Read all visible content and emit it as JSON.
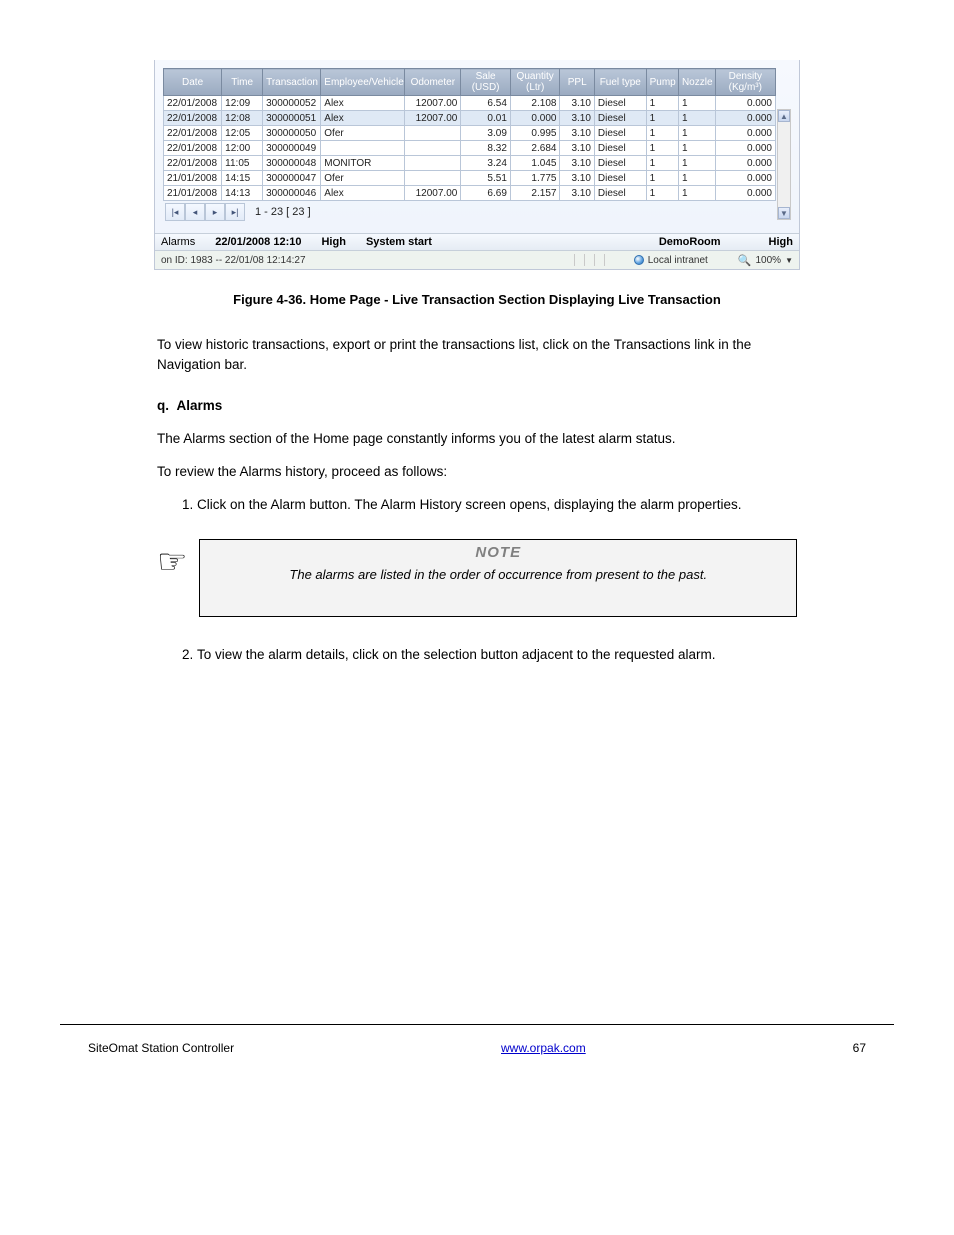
{
  "columns": {
    "date": "Date",
    "time": "Time",
    "txn": "Transaction",
    "emp": "Employee/Vehicle",
    "odo": "Odometer",
    "sale": "Sale",
    "sale_sub": "(USD)",
    "qty": "Quantity",
    "qty_sub": "(Ltr)",
    "ppl": "PPL",
    "fuel": "Fuel type",
    "pump": "Pump",
    "nozzle": "Nozzle",
    "density": "Density",
    "density_sub": "(Kg/m³)"
  },
  "rows": [
    {
      "date": "22/01/2008",
      "time": "12:09",
      "txn": "300000052",
      "emp": "Alex",
      "odo": "12007.00",
      "sale": "6.54",
      "qty": "2.108",
      "ppl": "3.10",
      "fuel": "Diesel",
      "pump": "1",
      "noz": "1",
      "dens": "0.000",
      "sel": false
    },
    {
      "date": "22/01/2008",
      "time": "12:08",
      "txn": "300000051",
      "emp": "Alex",
      "odo": "12007.00",
      "sale": "0.01",
      "qty": "0.000",
      "ppl": "3.10",
      "fuel": "Diesel",
      "pump": "1",
      "noz": "1",
      "dens": "0.000",
      "sel": true
    },
    {
      "date": "22/01/2008",
      "time": "12:05",
      "txn": "300000050",
      "emp": "Ofer",
      "odo": "",
      "sale": "3.09",
      "qty": "0.995",
      "ppl": "3.10",
      "fuel": "Diesel",
      "pump": "1",
      "noz": "1",
      "dens": "0.000",
      "sel": false
    },
    {
      "date": "22/01/2008",
      "time": "12:00",
      "txn": "300000049",
      "emp": "",
      "odo": "",
      "sale": "8.32",
      "qty": "2.684",
      "ppl": "3.10",
      "fuel": "Diesel",
      "pump": "1",
      "noz": "1",
      "dens": "0.000",
      "sel": false
    },
    {
      "date": "22/01/2008",
      "time": "11:05",
      "txn": "300000048",
      "emp": "MONITOR",
      "odo": "",
      "sale": "3.24",
      "qty": "1.045",
      "ppl": "3.10",
      "fuel": "Diesel",
      "pump": "1",
      "noz": "1",
      "dens": "0.000",
      "sel": false
    },
    {
      "date": "21/01/2008",
      "time": "14:15",
      "txn": "300000047",
      "emp": "Ofer",
      "odo": "",
      "sale": "5.51",
      "qty": "1.775",
      "ppl": "3.10",
      "fuel": "Diesel",
      "pump": "1",
      "noz": "1",
      "dens": "0.000",
      "sel": false
    },
    {
      "date": "21/01/2008",
      "time": "14:13",
      "txn": "300000046",
      "emp": "Alex",
      "odo": "12007.00",
      "sale": "6.69",
      "qty": "2.157",
      "ppl": "3.10",
      "fuel": "Diesel",
      "pump": "1",
      "noz": "1",
      "dens": "0.000",
      "sel": false
    }
  ],
  "pager": {
    "range": "1 - 23  [ 23 ]"
  },
  "alarms": {
    "label": "Alarms",
    "datetime": "22/01/2008 12:10",
    "severity1": "High",
    "event": "System start",
    "room": "DemoRoom",
    "severity2": "High"
  },
  "statusbar": {
    "session": "on ID: 1983 -- 22/01/08  12:14:27",
    "zone": "Local intranet",
    "zoom": "100%"
  },
  "caption": "Figure 4-36. Home Page - Live Transaction Section Displaying Live Transaction",
  "text": {
    "p1": "To view historic transactions, export or print the transactions list, click on the Transactions link in the Navigation bar.",
    "q_h": "Alarms",
    "q_p": "The Alarms section of the Home page constantly informs you of the latest alarm status.",
    "q_p2": "To review the Alarms history, proceed as follows:",
    "step": "Click on the Alarm button. The Alarm History screen opens, displaying the alarm properties.",
    "note": "The alarms are listed in the order of occurrence from present to the past.",
    "bottom": "To view the alarm details, click on the selection button adjacent to the requested alarm."
  },
  "note_title": "NOTE",
  "footer": {
    "title": "SiteOmat Station Controller",
    "link_text": "www.orpak.com",
    "page": "67"
  }
}
